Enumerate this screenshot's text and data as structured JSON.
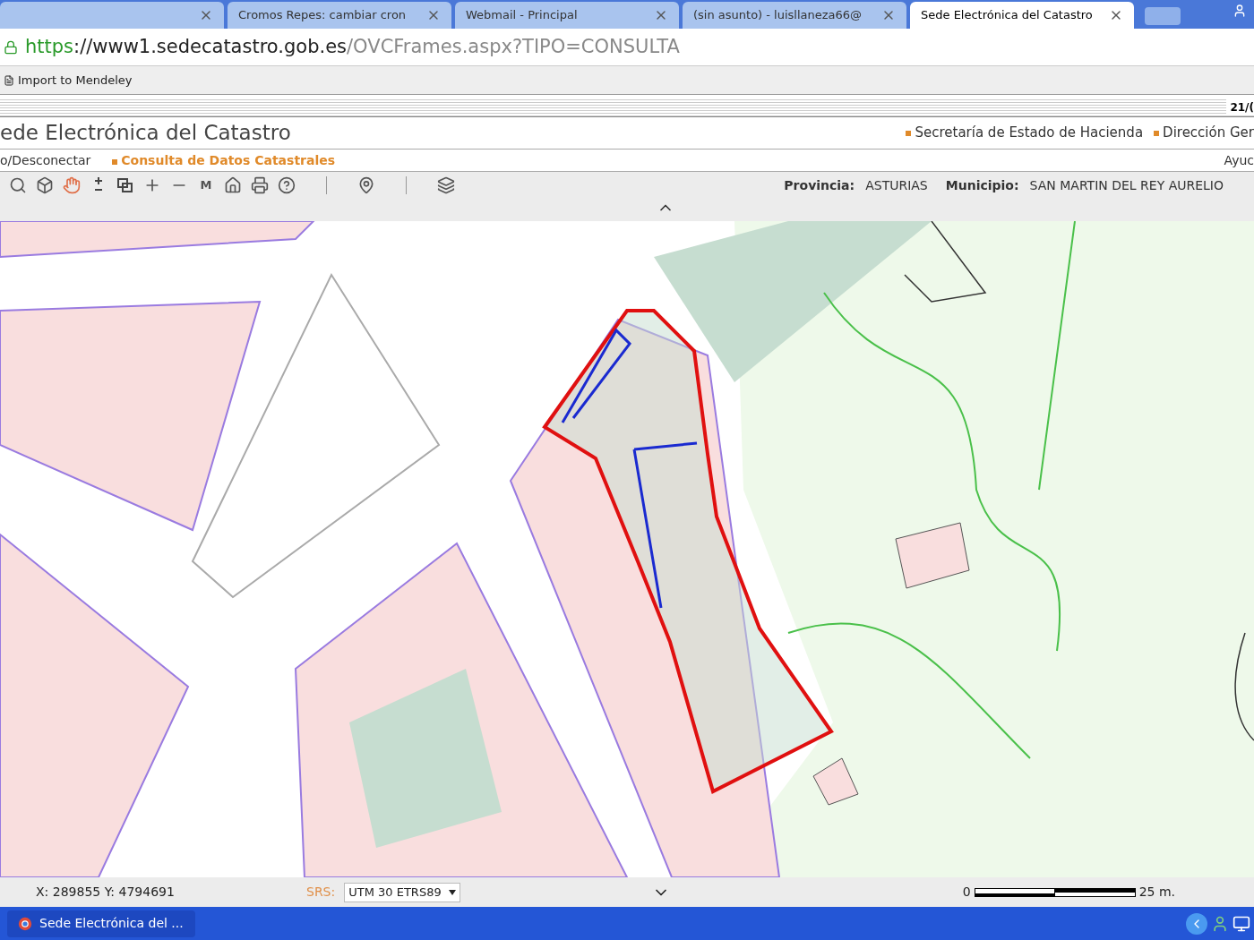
{
  "browser": {
    "tabs": [
      {
        "selected": false
      },
      {
        "label": "Cromos Repes: cambiar cron",
        "selected": false
      },
      {
        "label": "Webmail - Principal",
        "selected": false
      },
      {
        "label": "(sin asunto) - luisllaneza66@",
        "selected": false
      },
      {
        "label": "Sede Electrónica del Catastro",
        "selected": true
      }
    ],
    "url": {
      "scheme": "https",
      "host": "://www1.sedecatastro.gob.es",
      "path": "/OVCFrames.aspx?TIPO=CONSULTA"
    },
    "bookmarks": [
      "Import to Mendeley"
    ]
  },
  "page": {
    "date": "21/(",
    "site_title": "ede Electrónica del Catastro",
    "header_links": [
      "Secretaría de Estado de Hacienda",
      "Dirección Ger"
    ],
    "nav": {
      "left": "o/Desconectar",
      "current": "Consulta de Datos Catastrales",
      "right": "Ayuc"
    },
    "toolbar": {
      "measure_label": "M"
    },
    "location": [
      {
        "label": "Provincia:",
        "value": "ASTURIAS"
      },
      {
        "label": "Municipio:",
        "value": "SAN MARTIN DEL REY AURELIO"
      }
    ],
    "status": {
      "coordinates": "X: 289855 Y: 4794691",
      "srs_label": "SRS:",
      "srs_value": "UTM 30 ETRS89",
      "scale_start": "0",
      "scale_end": "25 m."
    }
  },
  "taskbar": {
    "window": "Sede Electrónica del ..."
  }
}
